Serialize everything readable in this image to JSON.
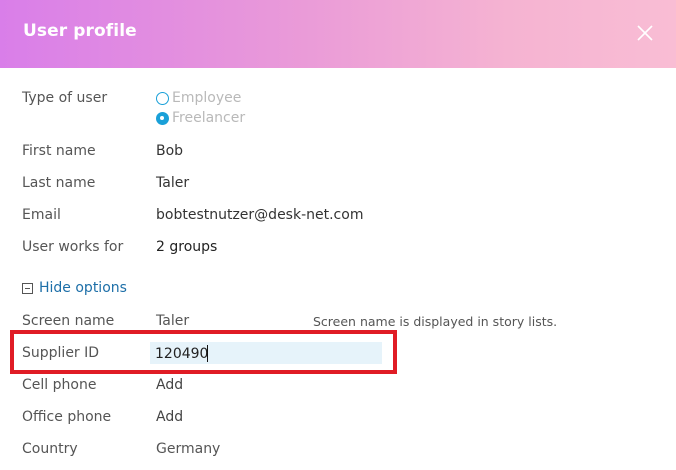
{
  "dialog": {
    "title": "User profile"
  },
  "form": {
    "type_of_user": {
      "label": "Type of user",
      "options": [
        {
          "label": "Employee",
          "checked": false
        },
        {
          "label": "Freelancer",
          "checked": true
        }
      ]
    },
    "first_name": {
      "label": "First name",
      "value": "Bob"
    },
    "last_name": {
      "label": "Last name",
      "value": "Taler"
    },
    "email": {
      "label": "Email",
      "value": "bobtestnutzer@desk-net.com"
    },
    "user_works_for": {
      "label": "User works for",
      "value": "2 groups"
    },
    "options_toggle": {
      "label": "Hide options"
    },
    "screen_name": {
      "label": "Screen name",
      "value": "Taler",
      "hint": "Screen name is displayed in story lists."
    },
    "supplier_id": {
      "label": "Supplier ID",
      "value": "120490"
    },
    "cell_phone": {
      "label": "Cell phone",
      "value": "Add"
    },
    "office_phone": {
      "label": "Office phone",
      "value": "Add"
    },
    "country": {
      "label": "Country",
      "value": "Germany"
    }
  },
  "colors": {
    "header_gradient_start": "#d97ee9",
    "header_gradient_end": "#f9bdd4",
    "accent_blue": "#1aa0d8",
    "link_blue": "#1d6fa8",
    "input_bg": "#e6f3fa",
    "highlight_red": "#e01c25"
  },
  "icons": {
    "close": "close-icon",
    "collapse": "minus-square-icon",
    "radio_unchecked": "radio-unchecked-icon",
    "radio_checked": "radio-checked-icon"
  }
}
